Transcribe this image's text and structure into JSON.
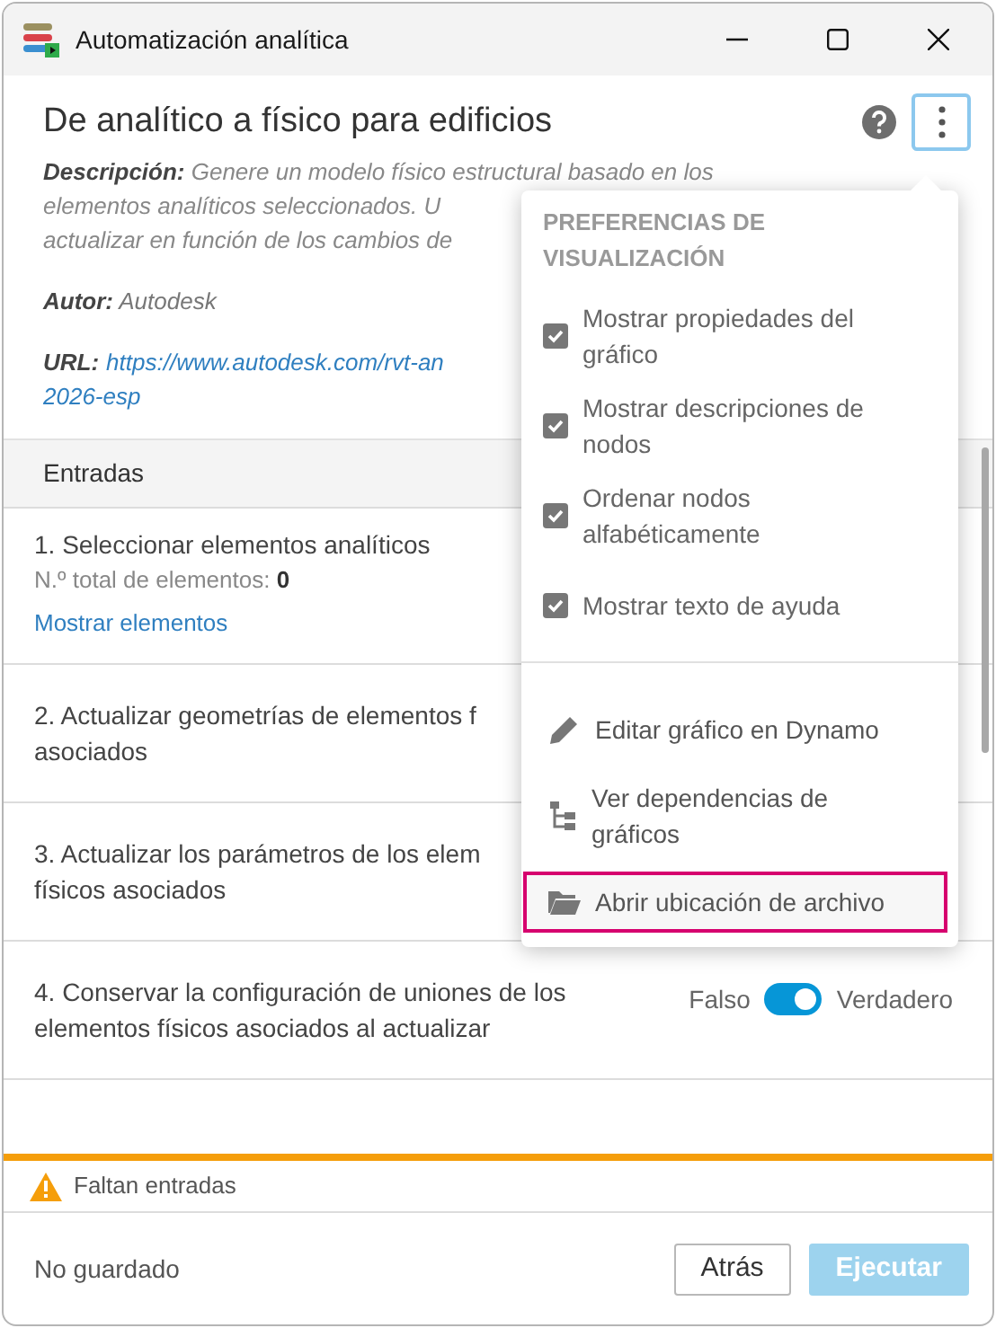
{
  "window": {
    "title": "Automatización analítica"
  },
  "header": {
    "title": "De analítico a físico para edificios"
  },
  "description": {
    "label": "Descripción:",
    "lines": [
      "Genere un modelo físico estructural basado en los",
      "elementos analíticos seleccionados. U",
      "actualizar en función de los cambios de"
    ]
  },
  "author": {
    "label": "Autor:",
    "value": "Autodesk"
  },
  "url": {
    "label": "URL:",
    "lines": [
      "https://www.autodesk.com/rvt-an",
      "2026-esp"
    ]
  },
  "inputs": {
    "title": "Entradas",
    "items": [
      {
        "kind": "selection",
        "lines": [
          "1. Seleccionar elementos analíticos"
        ],
        "count_label": "N.º total de elementos:",
        "count": "0",
        "link": "Mostrar elementos"
      },
      {
        "kind": "plain",
        "lines": [
          "2. Actualizar geometrías de elementos f",
          "asociados"
        ]
      },
      {
        "kind": "plain",
        "lines": [
          "3. Actualizar los parámetros de los elem",
          "físicos asociados"
        ]
      },
      {
        "kind": "toggle",
        "lines": [
          "4. Conservar la configuración de uniones de los",
          "elementos físicos asociados al actualizar"
        ],
        "off_label": "Falso",
        "on_label": "Verdadero",
        "on": true
      }
    ]
  },
  "status": {
    "kind": "warning",
    "text": "Faltan entradas"
  },
  "footer": {
    "save_state": "No guardado",
    "buttons": [
      {
        "label": "Atrás",
        "kind": "secondary",
        "disabled": false
      },
      {
        "label": "Ejecutar",
        "kind": "primary",
        "disabled": true
      }
    ]
  },
  "menu": {
    "heading": "PREFERENCIAS DE VISUALIZACIÓN",
    "options": [
      {
        "label": "Mostrar propiedades del gráfico",
        "checked": true
      },
      {
        "label": "Mostrar descripciones de nodos",
        "checked": true
      },
      {
        "label": "Ordenar nodos alfabéticamente",
        "checked": true
      },
      {
        "label": "Mostrar texto de ayuda",
        "checked": true
      }
    ],
    "actions": [
      {
        "label": "Editar gráfico en Dynamo",
        "kind": "edit",
        "selected": false
      },
      {
        "label": "Ver dependencias de gráficos",
        "kind": "dependencies",
        "selected": false
      },
      {
        "label": "Abrir ubicación de archivo",
        "kind": "folder",
        "selected": true
      }
    ]
  }
}
